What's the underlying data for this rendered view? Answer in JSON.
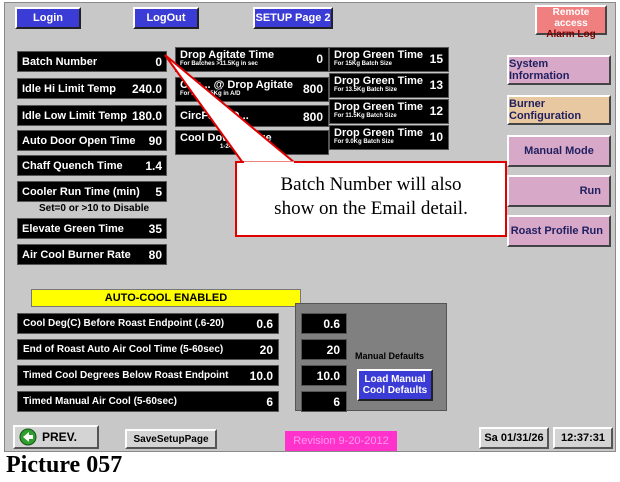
{
  "topbar": {
    "login": "Login",
    "logout": "LogOut",
    "setup_page": "SETUP Page 2",
    "alarm_line1": "Remote access",
    "alarm_line2": "Alarm Log"
  },
  "left_fields": [
    {
      "label": "Batch Number",
      "value": "0"
    },
    {
      "label": "Idle Hi Limit Temp",
      "value": "240.0"
    },
    {
      "label": "Idle Low Limit Temp",
      "value": "180.0"
    },
    {
      "label": "Auto Door Open Time",
      "value": "90"
    },
    {
      "label": "Chaff Quench Time",
      "value": "1.4"
    },
    {
      "label": "Cooler Run Time (min)",
      "value": "5"
    },
    {
      "label": "Elevate Green Time",
      "value": "35"
    },
    {
      "label": "Air Cool Burner Rate",
      "value": "80"
    }
  ],
  "cooler_hint": "Set=0 or >10 to Disable",
  "mid_fields": [
    {
      "label": "Drop Agitate Time",
      "sub": "For Batches >11.5Kg in sec",
      "value": "0"
    },
    {
      "label": "Circ... @ Drop Agitate",
      "sub": "For B... 11.5Kg in A/D",
      "value": "800"
    },
    {
      "label": "CircFan@D...",
      "sub": "",
      "value": "800"
    },
    {
      "label": "Cool Down Purge",
      "sub": "1-240 (...",
      "value": ""
    }
  ],
  "green_fields": [
    {
      "label": "Drop Green Time",
      "sub": "For 15Kg Batch Size",
      "value": "15"
    },
    {
      "label": "Drop Green Time",
      "sub": "For 13.5Kg Batch Size",
      "value": "13"
    },
    {
      "label": "Drop Green Time",
      "sub": "For 11.5Kg Batch Size",
      "value": "12"
    },
    {
      "label": "Drop Green Time",
      "sub": "For 9.0Kg Batch Size",
      "value": "10"
    }
  ],
  "side_buttons": {
    "system_info": "System Information",
    "burner_config": "Burner Configuration",
    "manual_mode": "Manual Mode",
    "run": "Run",
    "roast_profile_run": "Roast Profile Run"
  },
  "callout": {
    "line1": "Batch Number will also",
    "line2": "show on the Email detail."
  },
  "autocool": {
    "banner": "AUTO-COOL ENABLED",
    "rows": [
      {
        "label": "Cool Deg(C) Before Roast Endpoint (.6-20)",
        "value": "0.6"
      },
      {
        "label": "End of Roast Auto Air Cool Time (5-60sec)",
        "value": "20"
      },
      {
        "label": "Timed Cool Degrees Below Roast Endpoint",
        "value": "10.0"
      },
      {
        "label": "Timed Manual Air Cool (5-60sec)",
        "value": "6"
      }
    ]
  },
  "manual_defaults": {
    "values": [
      "0.6",
      "20",
      "10.0",
      "6"
    ],
    "label": "Manual Defaults",
    "load_line1": "Load Manual",
    "load_line2": "Cool Defaults"
  },
  "bottom": {
    "prev": "PREV.",
    "save": "SaveSetupPage",
    "revision": "Revision  9-20-2012",
    "date": "Sa 01/31/26",
    "time": "12:37:31"
  },
  "caption": "Picture 057",
  "colors": {
    "panel_bg": "#c8c8c8",
    "blue_button": "#3b3bd6",
    "pink_button": "#d8a8c8",
    "autocool_yellow": "#ffff00",
    "revision_pink": "#ff33cc",
    "callout_border": "#e00000"
  }
}
